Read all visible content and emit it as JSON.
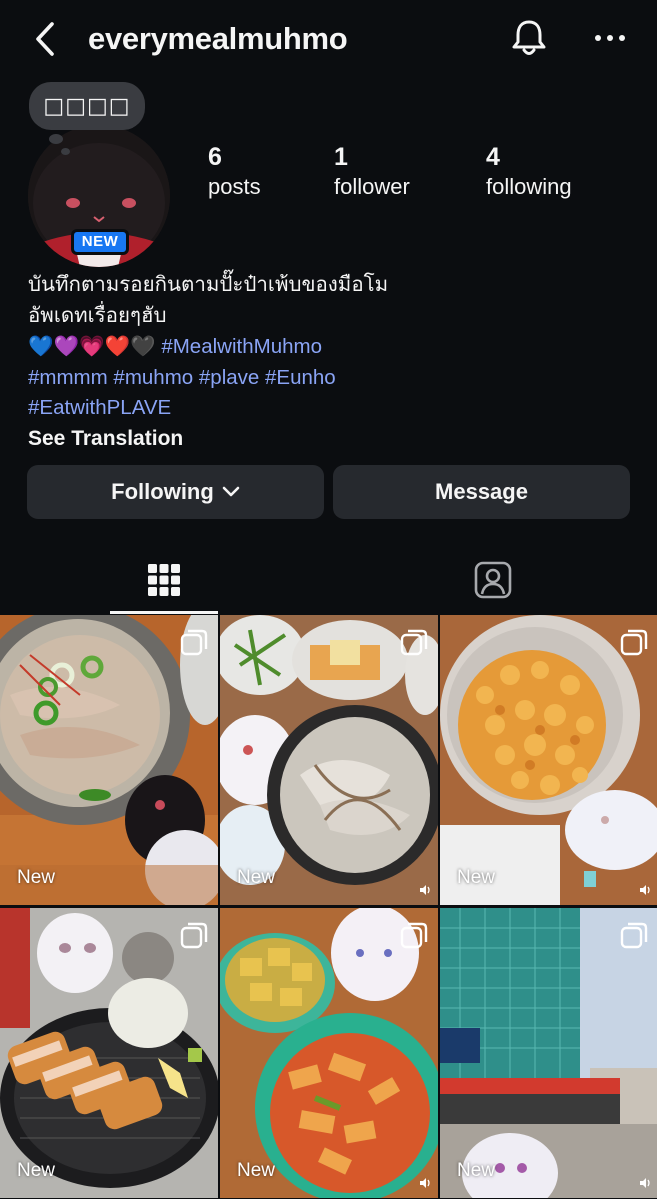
{
  "header": {
    "username": "everymealmuhmo",
    "icons": [
      "back-icon",
      "bell-icon",
      "more-icon"
    ]
  },
  "profile": {
    "note": "□□□□",
    "avatar_badge": "NEW",
    "stats": {
      "posts_count": "6",
      "posts_label": "posts",
      "followers_count": "1",
      "followers_label": "follower",
      "following_count": "4",
      "following_label": "following"
    }
  },
  "bio": {
    "line1": "บันทึกตามรอยกินตามปั๊ะป๋าเพ้บของมือโม",
    "line2": "อัพเดทเรื่อยๆฮับ",
    "emojis": "💙💜💗❤️🖤",
    "hashtag1": "#MealwithMuhmo",
    "hashtag2": "#mmmm",
    "hashtag3": "#muhmo",
    "hashtag4": "#plave",
    "hashtag5": "#Eunho",
    "hashtag6": "#EatwithPLAVE",
    "see_translation": "See Translation"
  },
  "actions": {
    "following_label": "Following",
    "message_label": "Message"
  },
  "tabs": {
    "active": "grid",
    "icons": [
      "grid-icon",
      "tagged-icon"
    ]
  },
  "posts": [
    {
      "label": "New",
      "subject": "cold noodles with peppers and plush toys",
      "multi": true,
      "video": false
    },
    {
      "label": "New",
      "subject": "pork soup with side dishes and plush toys",
      "multi": true,
      "video": true
    },
    {
      "label": "New",
      "subject": "sweet fried corn in a glass bowl",
      "multi": true,
      "video": true
    },
    {
      "label": "New",
      "subject": "tonkatsu with shredded cabbage and plush bear",
      "multi": true,
      "video": false
    },
    {
      "label": "New",
      "subject": "tteokbokki and fish cake soup with plush bear",
      "multi": true,
      "video": true
    },
    {
      "label": "New",
      "subject": "street with glass building and plush toy",
      "multi": true,
      "video": true
    }
  ],
  "colors": {
    "background": "#0b0d10",
    "button": "#26292e",
    "hashtag": "#8aa4f5",
    "badge": "#1877f2"
  }
}
